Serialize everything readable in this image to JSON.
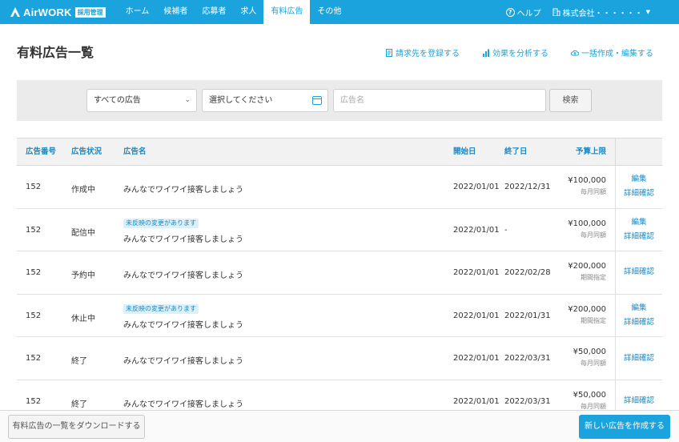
{
  "nav": {
    "logo_text": "AirWORK",
    "logo_badge": "採用管理",
    "items": [
      {
        "label": "ホーム",
        "active": false
      },
      {
        "label": "候補者",
        "active": false
      },
      {
        "label": "応募者",
        "active": false
      },
      {
        "label": "求人",
        "active": false
      },
      {
        "label": "有料広告",
        "active": true
      },
      {
        "label": "その他",
        "active": false
      }
    ],
    "help_label": "ヘルプ",
    "company_label": "株式会社・・・・・・",
    "accent_color": "#1ba3de"
  },
  "page": {
    "title": "有料広告一覧",
    "actions": [
      {
        "label": "請求先を登録する",
        "icon": "document-icon"
      },
      {
        "label": "効果を分析する",
        "icon": "bar-chart-icon"
      },
      {
        "label": "一括作成・編集する",
        "icon": "cloud-upload-icon"
      }
    ]
  },
  "filter": {
    "ad_type_selected": "すべての広告",
    "date_placeholder": "選択してください",
    "name_placeholder": "広告名",
    "search_label": "検索"
  },
  "table": {
    "headers": {
      "number": "広告番号",
      "status": "広告状況",
      "name": "広告名",
      "start": "開始日",
      "end": "終了日",
      "budget": "予算上限"
    },
    "rows": [
      {
        "number": "152",
        "status": "作成中",
        "tag": "",
        "name": "みんなでワイワイ接客しましょう",
        "start": "2022/01/01",
        "end": "2022/12/31",
        "amount": "¥100,000",
        "period": "毎月同額",
        "edit": "編集",
        "detail": "詳細確認"
      },
      {
        "number": "152",
        "status": "配信中",
        "tag": "未反映の変更があります",
        "name": "みんなでワイワイ接客しましょう",
        "start": "2022/01/01",
        "end": "-",
        "amount": "¥100,000",
        "period": "毎月同額",
        "edit": "編集",
        "detail": "詳細確認"
      },
      {
        "number": "152",
        "status": "予約中",
        "tag": "",
        "name": "みんなでワイワイ接客しましょう",
        "start": "2022/01/01",
        "end": "2022/02/28",
        "amount": "¥200,000",
        "period": "期間指定",
        "edit": "",
        "detail": "詳細確認"
      },
      {
        "number": "152",
        "status": "休止中",
        "tag": "未反映の変更があります",
        "name": "みんなでワイワイ接客しましょう",
        "start": "2022/01/01",
        "end": "2022/01/31",
        "amount": "¥200,000",
        "period": "期間指定",
        "edit": "編集",
        "detail": "詳細確認"
      },
      {
        "number": "152",
        "status": "終了",
        "tag": "",
        "name": "みんなでワイワイ接客しましょう",
        "start": "2022/01/01",
        "end": "2022/03/31",
        "amount": "¥50,000",
        "period": "毎月同額",
        "edit": "",
        "detail": "詳細確認"
      },
      {
        "number": "152",
        "status": "終了",
        "tag": "",
        "name": "みんなでワイワイ接客しましょう",
        "start": "2022/01/01",
        "end": "2022/03/31",
        "amount": "¥50,000",
        "period": "毎月同額",
        "edit": "",
        "detail": "詳細確認"
      }
    ]
  },
  "footer": {
    "download_label": "有料広告の一覧をダウンロードする",
    "create_label": "新しい広告を作成する"
  }
}
